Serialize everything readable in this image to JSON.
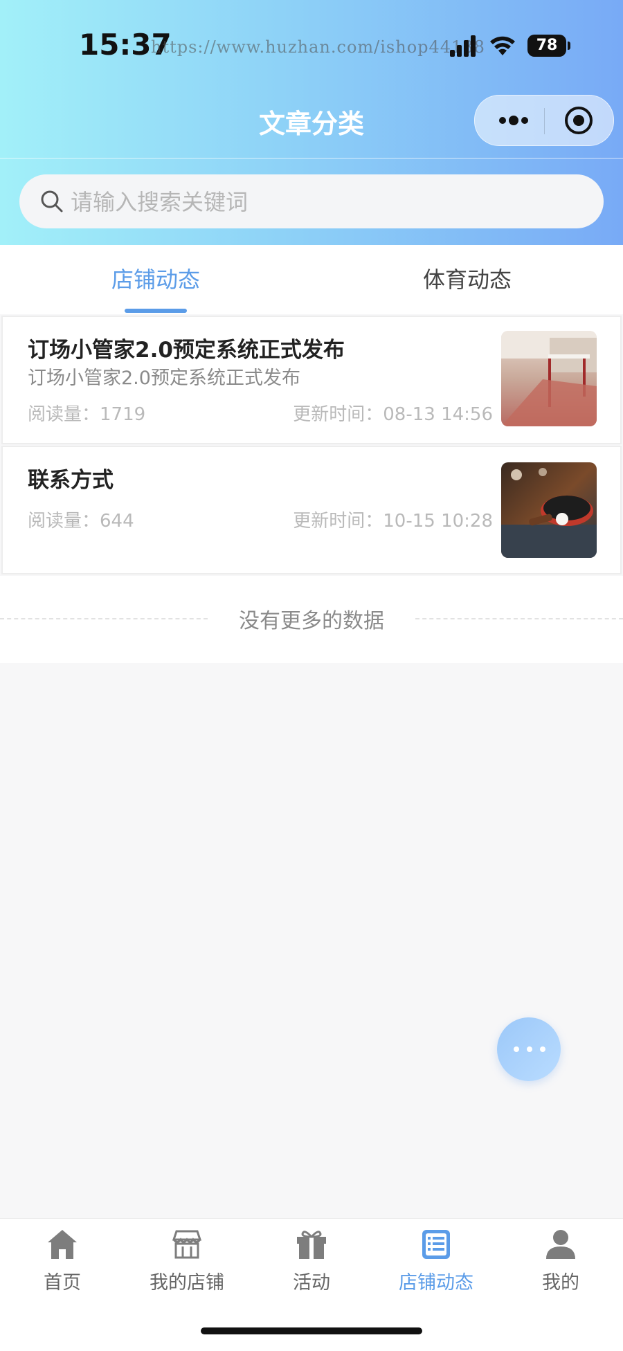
{
  "status_bar": {
    "time": "15:37",
    "watermark": "https://www.huzhan.com/ishop44138",
    "battery": "78"
  },
  "nav": {
    "title": "文章分类"
  },
  "search": {
    "placeholder": "请输入搜索关键词",
    "value": ""
  },
  "tabs": [
    {
      "label": "店铺动态",
      "active": true
    },
    {
      "label": "体育动态",
      "active": false
    }
  ],
  "articles": [
    {
      "title": "订场小管家2.0预定系统正式发布",
      "subtitle": "订场小管家2.0预定系统正式发布",
      "reads": "阅读量：1719",
      "updated": "更新时间：08-13 14:56",
      "thumb": "hurdles-photo"
    },
    {
      "title": "联系方式",
      "subtitle": "",
      "reads": "阅读量：644",
      "updated": "更新时间：10-15 10:28",
      "thumb": "table-tennis-photo"
    }
  ],
  "no_more": "没有更多的数据",
  "tabbar": [
    {
      "label": "首页",
      "icon": "home-icon",
      "active": false
    },
    {
      "label": "我的店铺",
      "icon": "store-icon",
      "active": false
    },
    {
      "label": "活动",
      "icon": "gift-icon",
      "active": false
    },
    {
      "label": "店铺动态",
      "icon": "list-icon",
      "active": true
    },
    {
      "label": "我的",
      "icon": "user-icon",
      "active": false
    }
  ],
  "colors": {
    "accent": "#5b9ce8",
    "header_gradient_start": "#a2f0f9",
    "header_gradient_end": "#78aaf6"
  }
}
